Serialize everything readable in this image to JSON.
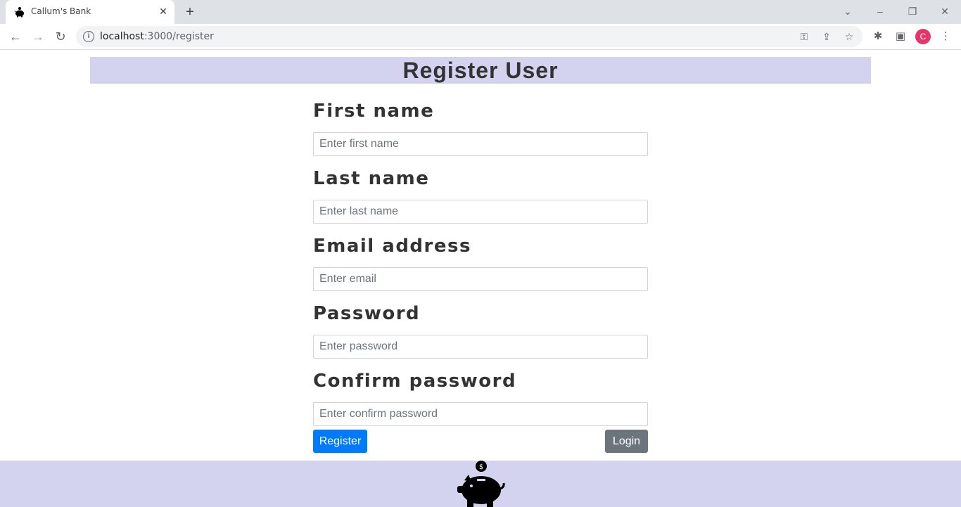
{
  "browser": {
    "tab_title": "Callum's Bank",
    "url_host": "localhost",
    "url_path": ":3000/register",
    "avatar_letter": "C"
  },
  "page": {
    "title": "Register User"
  },
  "form": {
    "first_name_label": "First name",
    "first_name_placeholder": "Enter first name",
    "last_name_label": "Last name",
    "last_name_placeholder": "Enter last name",
    "email_label": "Email address",
    "email_placeholder": "Enter email",
    "password_label": "Password",
    "password_placeholder": "Enter password",
    "confirm_label": "Confirm password",
    "confirm_placeholder": "Enter confirm password",
    "register_label": "Register",
    "login_label": "Login"
  },
  "colors": {
    "header_bg": "#d3d3ef",
    "primary": "#007bff",
    "secondary": "#6c757d",
    "avatar": "#e8336b"
  },
  "icons": {
    "tab_favicon": "piggy-bank-icon",
    "footer_logo": "piggy-bank-icon"
  }
}
